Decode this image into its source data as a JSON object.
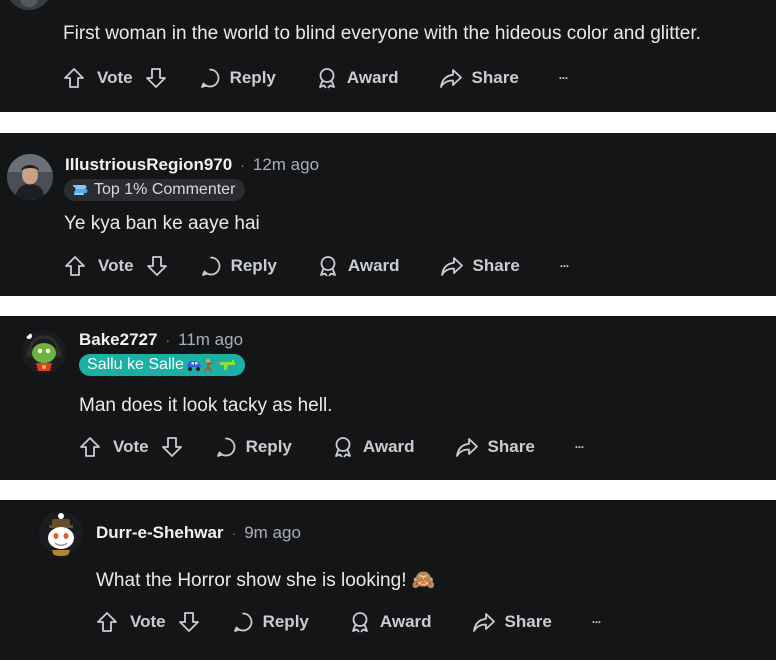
{
  "comments": [
    {
      "body": "First woman in the world to blind everyone with the hideous color and glitter.",
      "actions": {
        "vote": "Vote",
        "reply": "Reply",
        "award": "Award",
        "share": "Share"
      }
    },
    {
      "username": "IllustriousRegion970",
      "time": "12m ago",
      "flair": "Top 1% Commenter",
      "body": "Ye kya ban ke aaye hai",
      "actions": {
        "vote": "Vote",
        "reply": "Reply",
        "award": "Award",
        "share": "Share"
      }
    },
    {
      "username": "Bake2727",
      "time": "11m ago",
      "flair": "Sallu ke Salle",
      "body": "Man does it look tacky as hell.",
      "actions": {
        "vote": "Vote",
        "reply": "Reply",
        "award": "Award",
        "share": "Share"
      }
    },
    {
      "username": "Durr-e-Shehwar",
      "time": "9m ago",
      "body": "What the Horror show she is looking! 🙈",
      "actions": {
        "vote": "Vote",
        "reply": "Reply",
        "award": "Award",
        "share": "Share"
      }
    }
  ],
  "separator": "·",
  "more_label": "···",
  "colors": {
    "card_bg": "#141517",
    "gap_bg": "#ffffff",
    "teal_flair": "#1bb0a3",
    "action_text": "#c9cdd1"
  },
  "icons": [
    "upvote-icon",
    "downvote-icon",
    "reply-bubble-icon",
    "award-icon",
    "share-arrow-icon",
    "more-dots-icon",
    "commenter-badge-icon"
  ]
}
